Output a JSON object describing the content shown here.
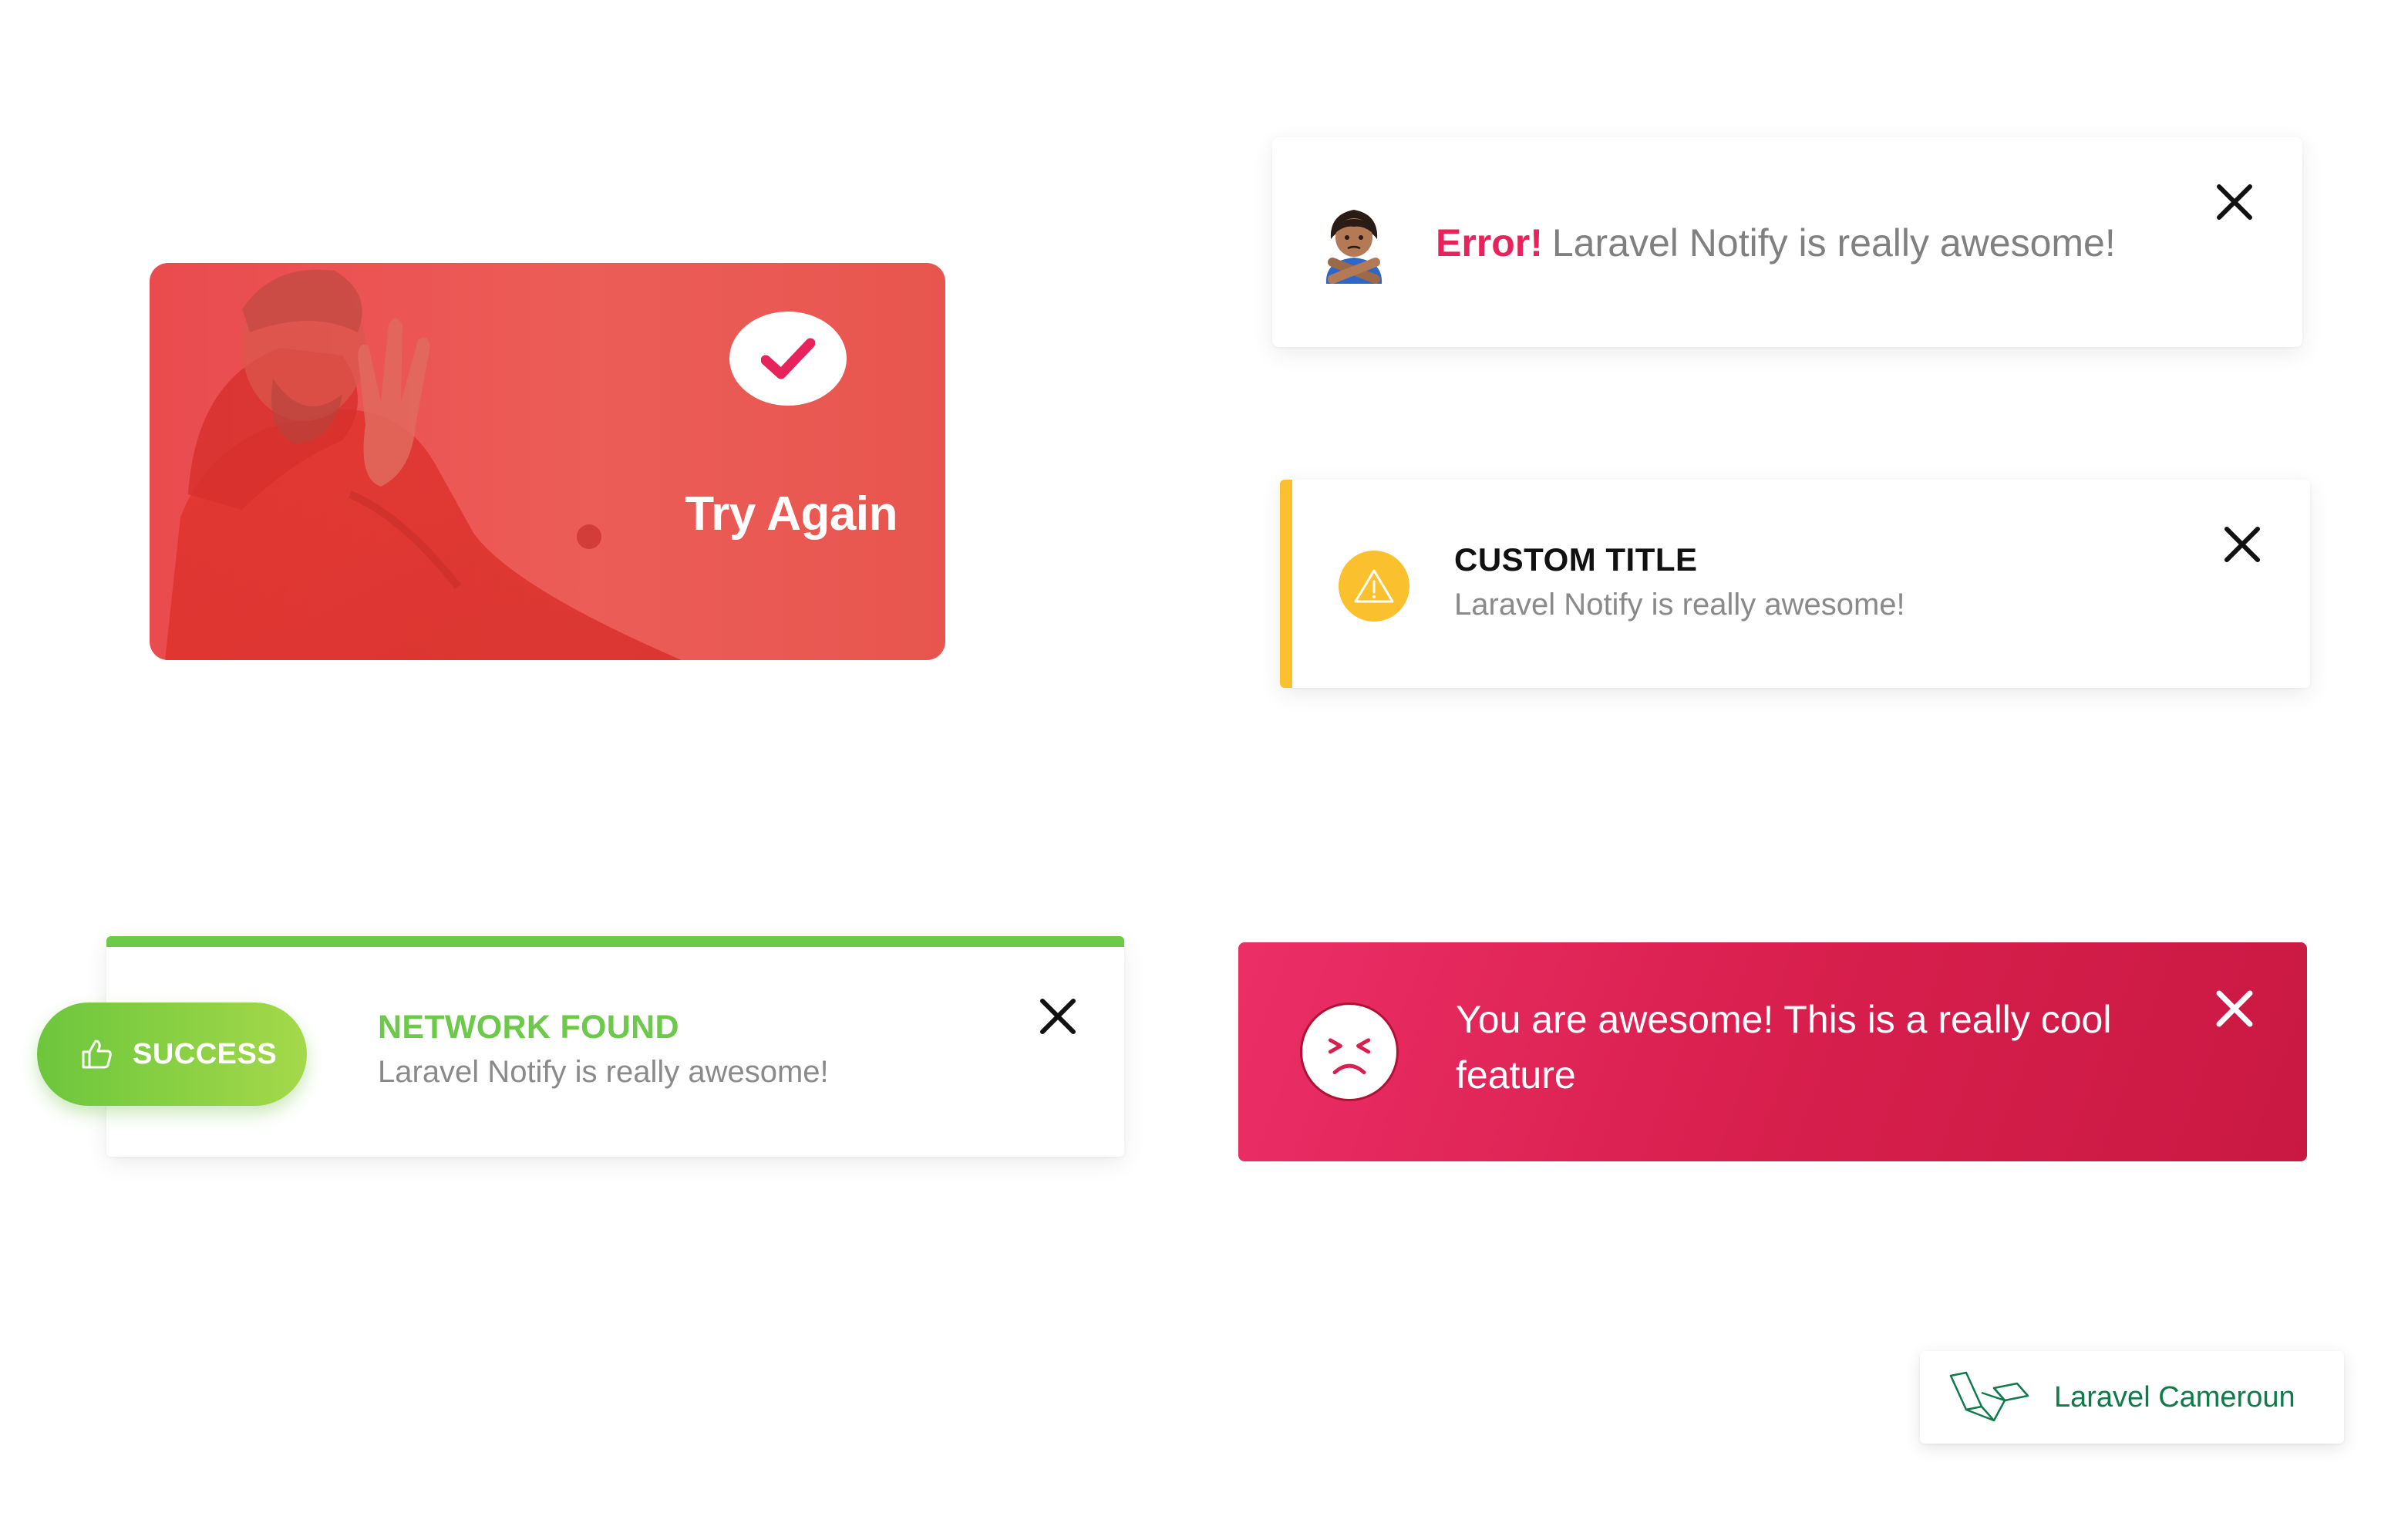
{
  "drake_card": {
    "label": "Try Again",
    "icon": "check-icon"
  },
  "error_card": {
    "emoji": "person-gesturing-no-emoji",
    "emphasis": "Error!",
    "message": "Laravel Notify is really awesome!",
    "close_icon": "close-icon"
  },
  "custom_card": {
    "icon": "warning-icon",
    "title": "CUSTOM TITLE",
    "message": "Laravel Notify is really awesome!",
    "accent": "#fbc02d"
  },
  "network_card": {
    "badge_label": "SUCCESS",
    "badge_icon": "thumbs-up-icon",
    "title": "NETWORK FOUND",
    "message": "Laravel Notify is really awesome!",
    "accent": "#6cc94a"
  },
  "awesome_card": {
    "icon": "sad-face-icon",
    "message": "You are awesome! This is a really cool feature",
    "accent": "#d81f4d"
  },
  "brand_badge": {
    "label": "Laravel Cameroun",
    "icon": "laravel-logo-icon"
  }
}
